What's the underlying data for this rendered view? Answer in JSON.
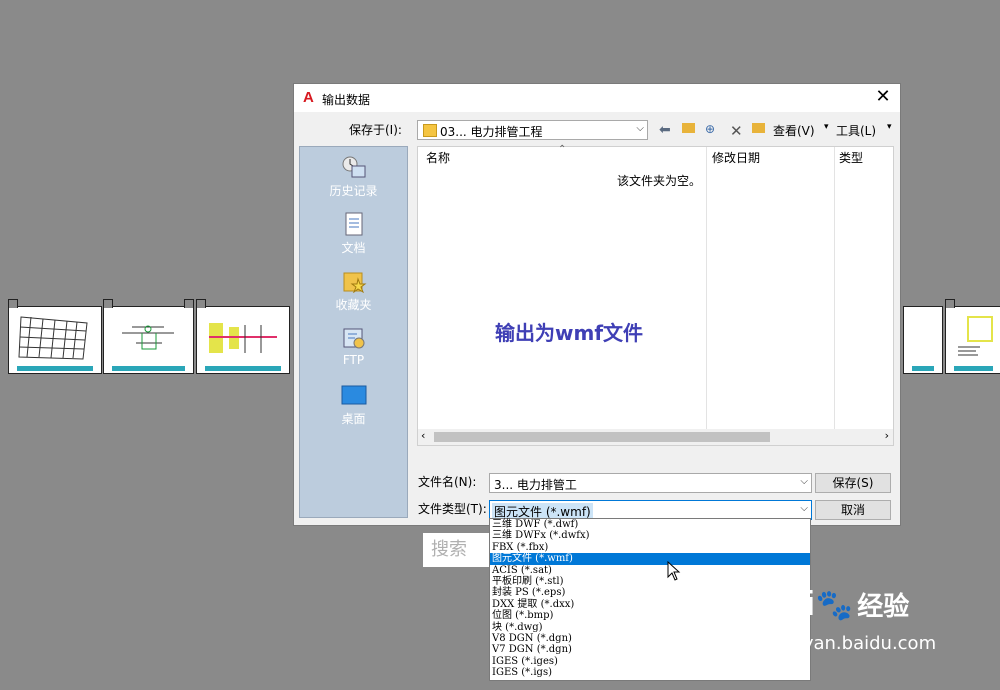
{
  "dialog": {
    "title": "输出数据",
    "close": "✕",
    "save_in_label": "保存于(I):",
    "save_in_value": "03... 电力排管工程",
    "toolbar": {
      "view_label": "查看(V)",
      "tools_label": "工具(L)"
    },
    "places": [
      "历史记录",
      "文档",
      "收藏夹",
      "FTP",
      "桌面"
    ],
    "columns": {
      "name": "名称",
      "modified": "修改日期",
      "type": "类型"
    },
    "empty_message": "该文件夹为空。",
    "overlay_text": "输出为wmf文件",
    "filename_label": "文件名(N):",
    "filename_value": "3... 电力排管工",
    "filetype_label": "文件类型(T):",
    "filetype_value": "图元文件 (*.wmf)",
    "save_button": "保存(S)",
    "cancel_button": "取消"
  },
  "filetype_options": [
    "三维 DWF (*.dwf)",
    "三维 DWFx (*.dwfx)",
    "FBX (*.fbx)",
    "图元文件 (*.wmf)",
    "ACIS (*.sat)",
    "平板印刷 (*.stl)",
    "封装 PS (*.eps)",
    "DXX 提取 (*.dxx)",
    "位图 (*.bmp)",
    "块 (*.dwg)",
    "V8 DGN (*.dgn)",
    "V7 DGN (*.dgn)",
    "IGES (*.iges)",
    "IGES (*.igs)"
  ],
  "selected_option_index": 3,
  "search_placeholder": "搜索",
  "watermark": {
    "logo": "Bai",
    "brand": "经验",
    "url": "jingyan.baidu.com"
  },
  "colors": {
    "selection": "#0078d7",
    "overlay_text": "#3f3fb5",
    "places_bg": "#bcccdd"
  }
}
